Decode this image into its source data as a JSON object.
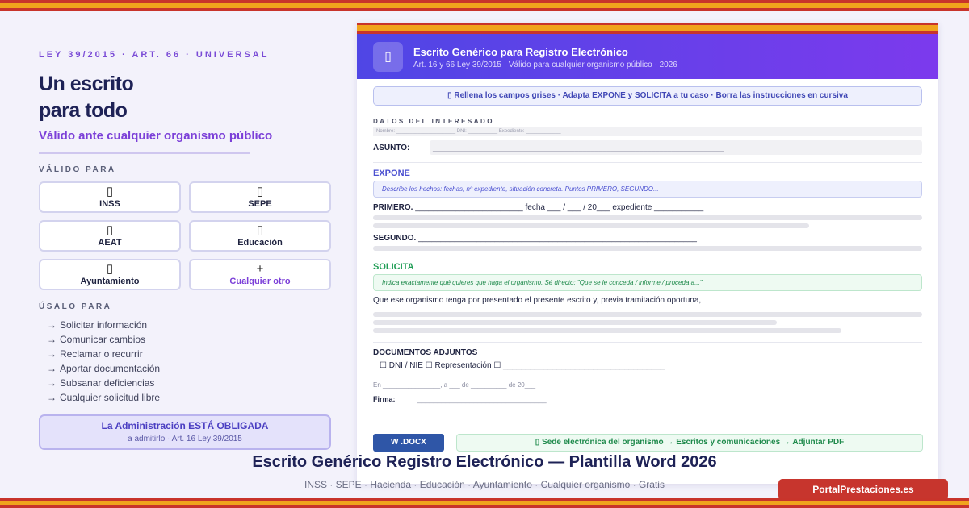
{
  "left": {
    "kicker": "LEY 39/2015 · ART. 66 · UNIVERSAL",
    "headline_1": "Un escrito",
    "headline_2": "para todo",
    "subline": "Válido ante cualquier organismo público",
    "valid_label": "VÁLIDO PARA",
    "orgs": [
      {
        "icon": "hospital-icon",
        "glyph": "▯",
        "label": "INSS"
      },
      {
        "icon": "briefcase-icon",
        "glyph": "▯",
        "label": "SEPE"
      },
      {
        "icon": "money-icon",
        "glyph": "▯",
        "label": "AEAT"
      },
      {
        "icon": "graduation-icon",
        "glyph": "▯",
        "label": "Educación"
      },
      {
        "icon": "town-hall-icon",
        "glyph": "▯",
        "label": "Ayuntamiento"
      },
      {
        "icon": "plus-icon",
        "glyph": "+",
        "label": "Cualquier otro"
      }
    ],
    "uses_label": "ÚSALO PARA",
    "uses": [
      "Solicitar información",
      "Comunicar cambios",
      "Reclamar o recurrir",
      "Aportar documentación",
      "Subsanar deficiencias",
      "Cualquier solicitud libre"
    ],
    "obligation_title": "La Administración ESTÁ OBLIGADA",
    "obligation_sub": "a admitirlo · Art. 16 Ley 39/2015"
  },
  "doc": {
    "icon": "document-icon",
    "icon_glyph": "▯",
    "title": "Escrito Genérico para Registro Electrónico",
    "subtitle": "Art. 16 y 66 Ley 39/2015 · Válido para cualquier organismo público · 2026",
    "instructions": "▯ Rellena los campos grises · Adapta EXPONE y SOLICITA a tu caso · Borra las instrucciones en cursiva",
    "datos_label": "DATOS DEL INTERESADO",
    "datos_fields": "Nombre: ______________________ DNI: ___________ Expediente: _____________",
    "asunto_label": "ASUNTO:",
    "asunto_value": "________________________________________________________________________",
    "expone_label": "EXPONE",
    "expone_hint": "Describe los hechos: fechas, nº expediente, situación concreta. Puntos PRIMERO, SEGUNDO...",
    "primero_label": "PRIMERO.",
    "primero_text": " ________________________ fecha ___ / ___ / 20___ expediente ___________",
    "segundo_label": "SEGUNDO.",
    "segundo_text": " ______________________________________________________________",
    "solicita_label": "SOLICITA",
    "solicita_hint": "Indica exactamente qué quieres que haga el organismo. Sé directo: \"Que se le conceda / informe / proceda a...\"",
    "solicita_text": "Que ese organismo tenga por presentado el presente escrito y, previa tramitación oportuna,",
    "documentos_label": "DOCUMENTOS ADJUNTOS",
    "documentos_text": "☐ DNI / NIE ☐ Representación ☐ ____________________________________",
    "lugar_fecha": "En ________________, a ___ de __________ de 20___",
    "firma_label": "Firma:",
    "firma_line": "________________________________",
    "docx_button": "W .DOCX",
    "sede_text": "▯ Sede electrónica del organismo → Escritos y comunicaciones → Adjuntar PDF"
  },
  "footer": {
    "title": "Escrito Genérico Registro Electrónico — Plantilla Word 2026",
    "subtitle": "INSS · SEPE · Hacienda · Educación · Ayuntamiento · Cualquier organismo · Gratis",
    "brand": "PortalPrestaciones.es"
  }
}
